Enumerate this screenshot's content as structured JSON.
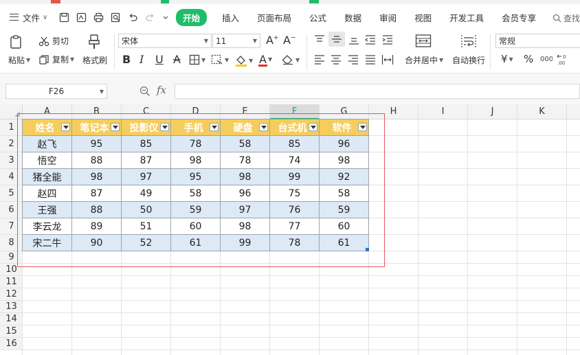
{
  "menu": {
    "file_label": "文件",
    "items": [
      "开始",
      "插入",
      "页面布局",
      "公式",
      "数据",
      "审阅",
      "视图",
      "开发工具",
      "会员专享"
    ],
    "active_index": 0,
    "search_label": "查找"
  },
  "ribbon": {
    "paste": "粘贴",
    "cut": "剪切",
    "copy": "复制",
    "format_painter": "格式刷",
    "font_name": "宋体",
    "font_size": "11",
    "number_format": "常规",
    "merge_center": "合并居中",
    "wrap_text": "自动换行",
    "currency_symbol": "¥",
    "percent_symbol": "%"
  },
  "formula_bar": {
    "name_box": "F26",
    "fx_label": "fx",
    "formula": ""
  },
  "sheet": {
    "columns": [
      "A",
      "B",
      "C",
      "D",
      "E",
      "F",
      "G",
      "H",
      "I",
      "J",
      "K"
    ],
    "selected_column": "F",
    "rows": [
      "1",
      "2",
      "3",
      "4",
      "5",
      "6",
      "7",
      "8",
      "9",
      "10",
      "11",
      "12",
      "13",
      "14",
      "15",
      "16"
    ],
    "table_header": [
      "姓名",
      "笔记本",
      "投影仪",
      "手机",
      "硬盘",
      "台式机",
      "软件"
    ],
    "table_rows": [
      [
        "赵飞",
        "95",
        "85",
        "78",
        "58",
        "85",
        "96"
      ],
      [
        "悟空",
        "88",
        "87",
        "98",
        "78",
        "74",
        "98"
      ],
      [
        "猪全能",
        "98",
        "97",
        "95",
        "98",
        "99",
        "92"
      ],
      [
        "赵四",
        "87",
        "49",
        "58",
        "96",
        "75",
        "58"
      ],
      [
        "王强",
        "88",
        "50",
        "59",
        "97",
        "76",
        "59"
      ],
      [
        "李云龙",
        "89",
        "51",
        "60",
        "98",
        "77",
        "60"
      ],
      [
        "宋二牛",
        "90",
        "52",
        "61",
        "99",
        "78",
        "61"
      ]
    ]
  },
  "colors": {
    "accent_green": "#1fbd6b",
    "header_fill": "#f5cd5f",
    "band_fill": "#dde9f5",
    "selection_red": "#e8545a"
  }
}
